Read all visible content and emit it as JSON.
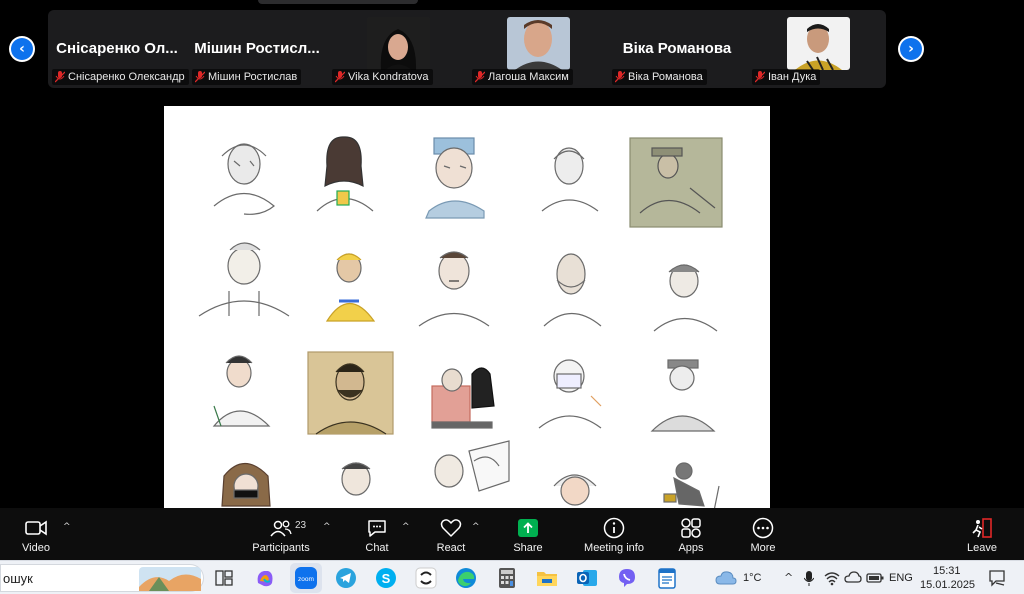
{
  "participants": [
    {
      "big_name": "Снісаренко Ол...",
      "label": "Снісаренко Олександр",
      "has_video": false
    },
    {
      "big_name": "Мішин Ростисл...",
      "label": "Мішин Ростислав",
      "has_video": false
    },
    {
      "big_name": "",
      "label": "Vika Kondratova",
      "has_video": true
    },
    {
      "big_name": "",
      "label": "Лагоша Максим",
      "has_video": true
    },
    {
      "big_name": "Віка Романова",
      "label": "Віка Романова",
      "has_video": false
    },
    {
      "big_name": "",
      "label": "Іван Дука",
      "has_video": true
    }
  ],
  "toolbar": {
    "video": "Video",
    "participants": "Participants",
    "participants_count": "23",
    "chat": "Chat",
    "react": "React",
    "share": "Share",
    "meeting_info": "Meeting info",
    "apps": "Apps",
    "more": "More",
    "leave": "Leave"
  },
  "taskbar": {
    "search_text": "ошук",
    "weather": "1°C",
    "lang": "ENG",
    "time": "15:31",
    "date": "15.01.2025"
  },
  "colors": {
    "zoom_blue": "#0e72ed",
    "share_green": "#00b050",
    "leave_red": "#e02828"
  }
}
